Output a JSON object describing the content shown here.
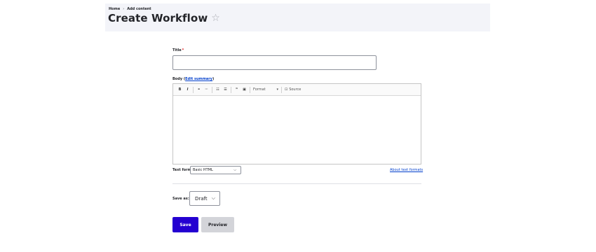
{
  "breadcrumb": {
    "home": "Home",
    "separator": "›",
    "add_content": "Add content"
  },
  "page": {
    "title": "Create Workflow",
    "favorite_icon": "☆"
  },
  "form": {
    "title_label": "Title",
    "required_marker": "*",
    "title_value": "",
    "body_label_prefix": "Body (",
    "body_summary_link": "Edit summary",
    "body_label_suffix": ")",
    "toolbar": {
      "bold": "B",
      "italic": "I",
      "link_icon": "⚭",
      "unlink_icon": "⚮",
      "bullet_list_icon": "☷",
      "numbered_list_icon": "☰",
      "blockquote_icon": "❞",
      "image_icon": "▣",
      "format_label": "Format",
      "format_caret": "▾",
      "source_icon": "⊡",
      "source_label": "Source"
    },
    "text_format_label": "Text format",
    "text_format_value": "Basic HTML",
    "text_format_caret": "⌵",
    "about_text_formats": "About text formats",
    "save_as_label": "Save as:",
    "save_as_value": "Draft",
    "save_as_caret": "⌵"
  },
  "actions": {
    "save": "Save",
    "preview": "Preview"
  },
  "colors": {
    "primary": "#2400d1",
    "link": "#003ecc",
    "required": "#dc2323",
    "header_bg": "#f3f4f9"
  }
}
